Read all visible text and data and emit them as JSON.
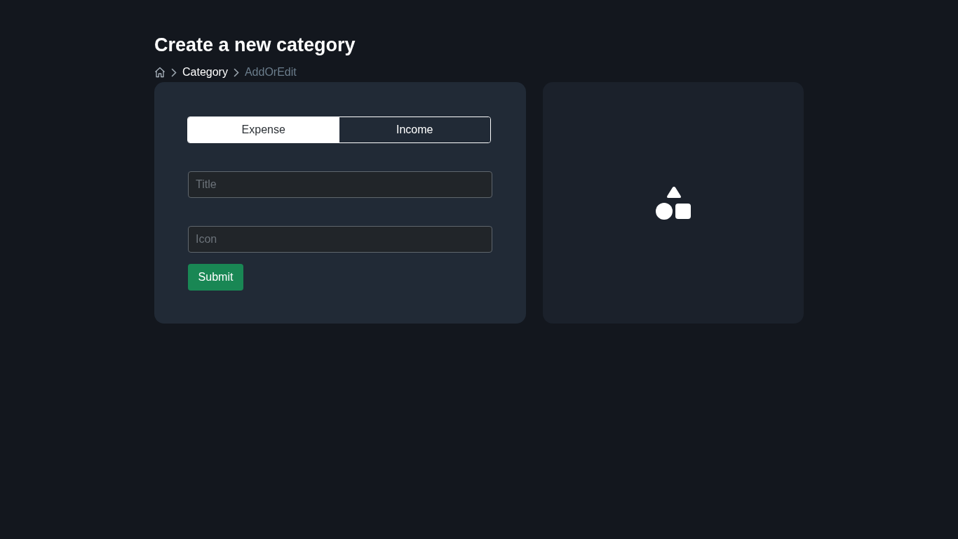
{
  "page": {
    "title": "Create a new category"
  },
  "breadcrumb": [
    {
      "kind": "home"
    },
    {
      "kind": "link",
      "label": "Category"
    },
    {
      "kind": "current",
      "label": "AddOrEdit"
    }
  ],
  "form": {
    "type_tabs": [
      {
        "label": "Expense",
        "selected": true
      },
      {
        "label": "Income",
        "selected": false
      }
    ],
    "fields": [
      {
        "placeholder": "Title"
      },
      {
        "placeholder": "Icon"
      }
    ],
    "submit": "Submit"
  }
}
